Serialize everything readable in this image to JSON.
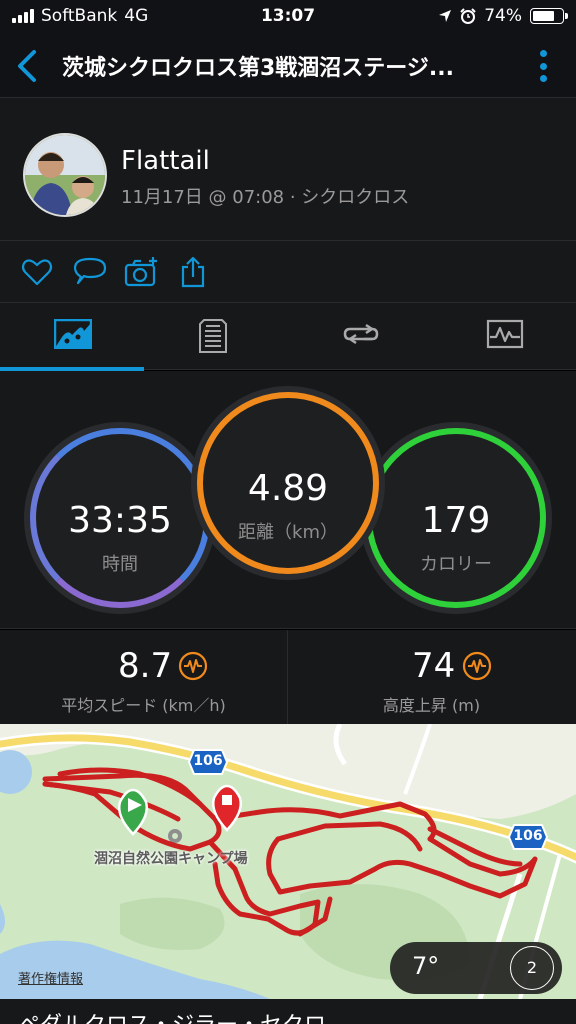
{
  "status": {
    "carrier": "SoftBank",
    "network": "4G",
    "time": "13:07",
    "battery": "74%",
    "battery_level": 0.74
  },
  "nav": {
    "title": "茨城シクロクロス第3戦涸沼ステージ..."
  },
  "profile": {
    "name": "Flattail",
    "meta": "11月17日 @ 07:08 · シクロクロス"
  },
  "actions": [
    "heart-icon",
    "comment-icon",
    "camera-plus-icon",
    "share-icon"
  ],
  "tabs": [
    "summary-tab",
    "details-tab",
    "laps-tab",
    "charts-tab"
  ],
  "stats": {
    "time": {
      "value": "33:35",
      "label": "時間",
      "color": "#4a7fe0"
    },
    "distance": {
      "value": "4.89",
      "label": "距離（km）",
      "color": "#f08a1c"
    },
    "calories": {
      "value": "179",
      "label": "カロリー",
      "color": "#2fd13a"
    }
  },
  "small": {
    "speed": {
      "value": "8.7",
      "label": "平均スピード (km／h)"
    },
    "ascent": {
      "value": "74",
      "label": "高度上昇 (m)"
    }
  },
  "map": {
    "place": "涸沼自然公園キャンプ場",
    "road1": "106",
    "road2": "106",
    "copyright": "著作権情報",
    "temperature": "7°",
    "dial": "2"
  },
  "bottom": {
    "text": "ペダルクロス・ジラー・セクロ"
  }
}
